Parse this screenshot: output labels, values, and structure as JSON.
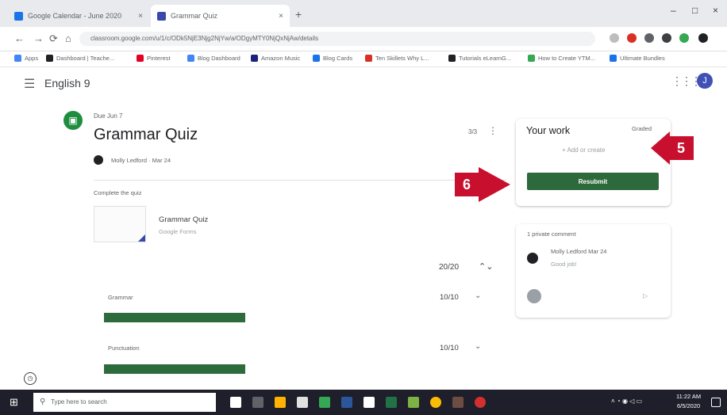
{
  "browser": {
    "tabs": [
      {
        "label": "Google Calendar - June 2020",
        "color": "#1a73e8"
      },
      {
        "label": "Grammar Quiz",
        "color": "#3949ab"
      }
    ],
    "new_tab": "+",
    "window_controls": [
      "–",
      "□",
      "×"
    ],
    "url": "classroom.google.com/u/1/c/ODk5NjE3Njg2NjYw/a/ODgyMTY0NjQxNjAw/details",
    "bookmarks": [
      "Apps",
      "Dashboard | Teache...",
      "Pinterest",
      "Blog Dashboard",
      "Amazon Music",
      "Blog Cards",
      "Ten Skillets Why L...",
      "Tutorials eLearnG...",
      "How to Create YTM...",
      "Ultimate Bundles"
    ]
  },
  "header": {
    "course": "English 9",
    "avatar_letter": "J"
  },
  "assignment": {
    "due": "Due Jun 7",
    "title": "Grammar Quiz",
    "author": "Molly Ledford · Mar 24",
    "points": "3/3",
    "description": "Complete the quiz",
    "attachment_title": "Grammar Quiz",
    "attachment_sub": "Google Forms",
    "total_score": "20/20"
  },
  "categories": [
    {
      "label": "Grammar",
      "score": "10/10",
      "fraction": 1.0
    },
    {
      "label": "Punctuation",
      "score": "10/10",
      "fraction": 1.0
    }
  ],
  "work": {
    "title": "Your work",
    "status": "Graded",
    "add_create": "+ Add or create",
    "resubmit": "Resubmit"
  },
  "comments": {
    "heading": "1 private comment",
    "author": "Molly Ledford  Mar 24",
    "text": "Good job!",
    "send_icon": "send-icon"
  },
  "callouts": {
    "five": "5",
    "six": "6"
  },
  "taskbar": {
    "search_placeholder": "Type here to search",
    "time": "11:22 AM",
    "date": "6/5/2020"
  },
  "colors": {
    "accent_green": "#2d6a3b",
    "callout_red": "#c8102e",
    "taskbar": "#1f1f2b"
  }
}
